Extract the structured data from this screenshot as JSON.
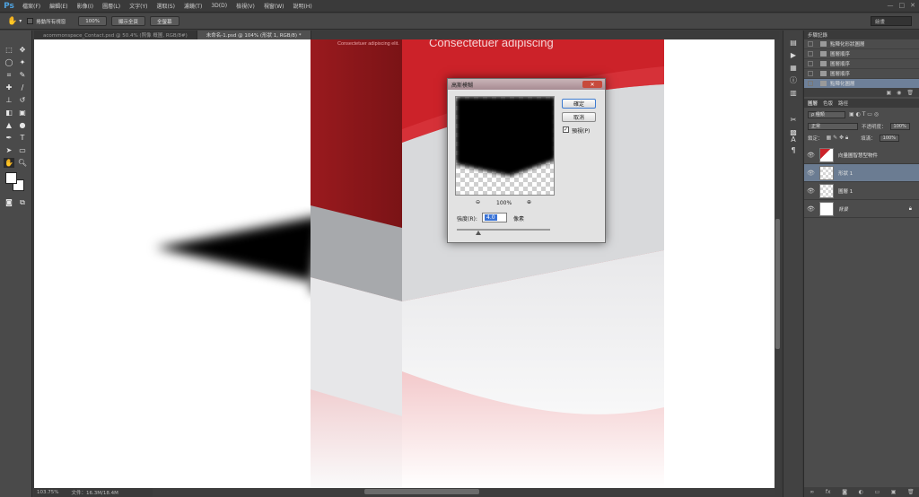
{
  "app": {
    "logo": "Ps"
  },
  "menu": [
    "檔案(F)",
    "編輯(E)",
    "影像(I)",
    "圖層(L)",
    "文字(Y)",
    "選取(S)",
    "濾鏡(T)",
    "3D(D)",
    "檢視(V)",
    "視窗(W)",
    "說明(H)"
  ],
  "window_controls": {
    "minimize": "—",
    "maximize": "□",
    "close": "✕"
  },
  "options_bar": {
    "scroll_all_label": "捲動所有視窗",
    "zoom_100": "100%",
    "fit_screen": "顯示全頁",
    "fill_screen": "全螢幕",
    "workspace": "繪畫"
  },
  "tabs": [
    {
      "label": "acommonspace_Contact.psd @ 50.4% (照像 概圖, RGB/8#)"
    },
    {
      "label": "未命名-1.psd @ 104% (形狀 1, RGB/8) *"
    }
  ],
  "canvas_text": {
    "headline": "Consectetuer adipiscing",
    "small": "Consectetuer adipiscing elit."
  },
  "status": {
    "zoom": "103.75%",
    "doc": "文件：16.3M/18.4M"
  },
  "history": {
    "tabs": [
      "步驟記錄"
    ],
    "items": [
      "點陣化形狀圖層",
      "圖層順序",
      "圖層順序",
      "圖層順序",
      "點陣化圖層"
    ]
  },
  "layers_panel": {
    "tabs": [
      "圖層",
      "色版",
      "路徑"
    ],
    "filter": "ρ 種類",
    "blend": "正常",
    "opacity_label": "不透明度：",
    "opacity": "100%",
    "lock_label": "鎖定：",
    "fill_label": "填滿：",
    "fill": "100%",
    "layers": [
      {
        "name": "向量圖智慧型物件"
      },
      {
        "name": "形狀 1"
      },
      {
        "name": "圖層 1"
      },
      {
        "name": "背景"
      }
    ]
  },
  "dialog": {
    "title": "高斯模糊",
    "close": "✕",
    "ok": "確定",
    "cancel": "取消",
    "preview_label": "預視(P)",
    "zoom_level": "100%",
    "radius_label": "強度(R):",
    "radius_value": "4.0",
    "unit": "像素"
  }
}
